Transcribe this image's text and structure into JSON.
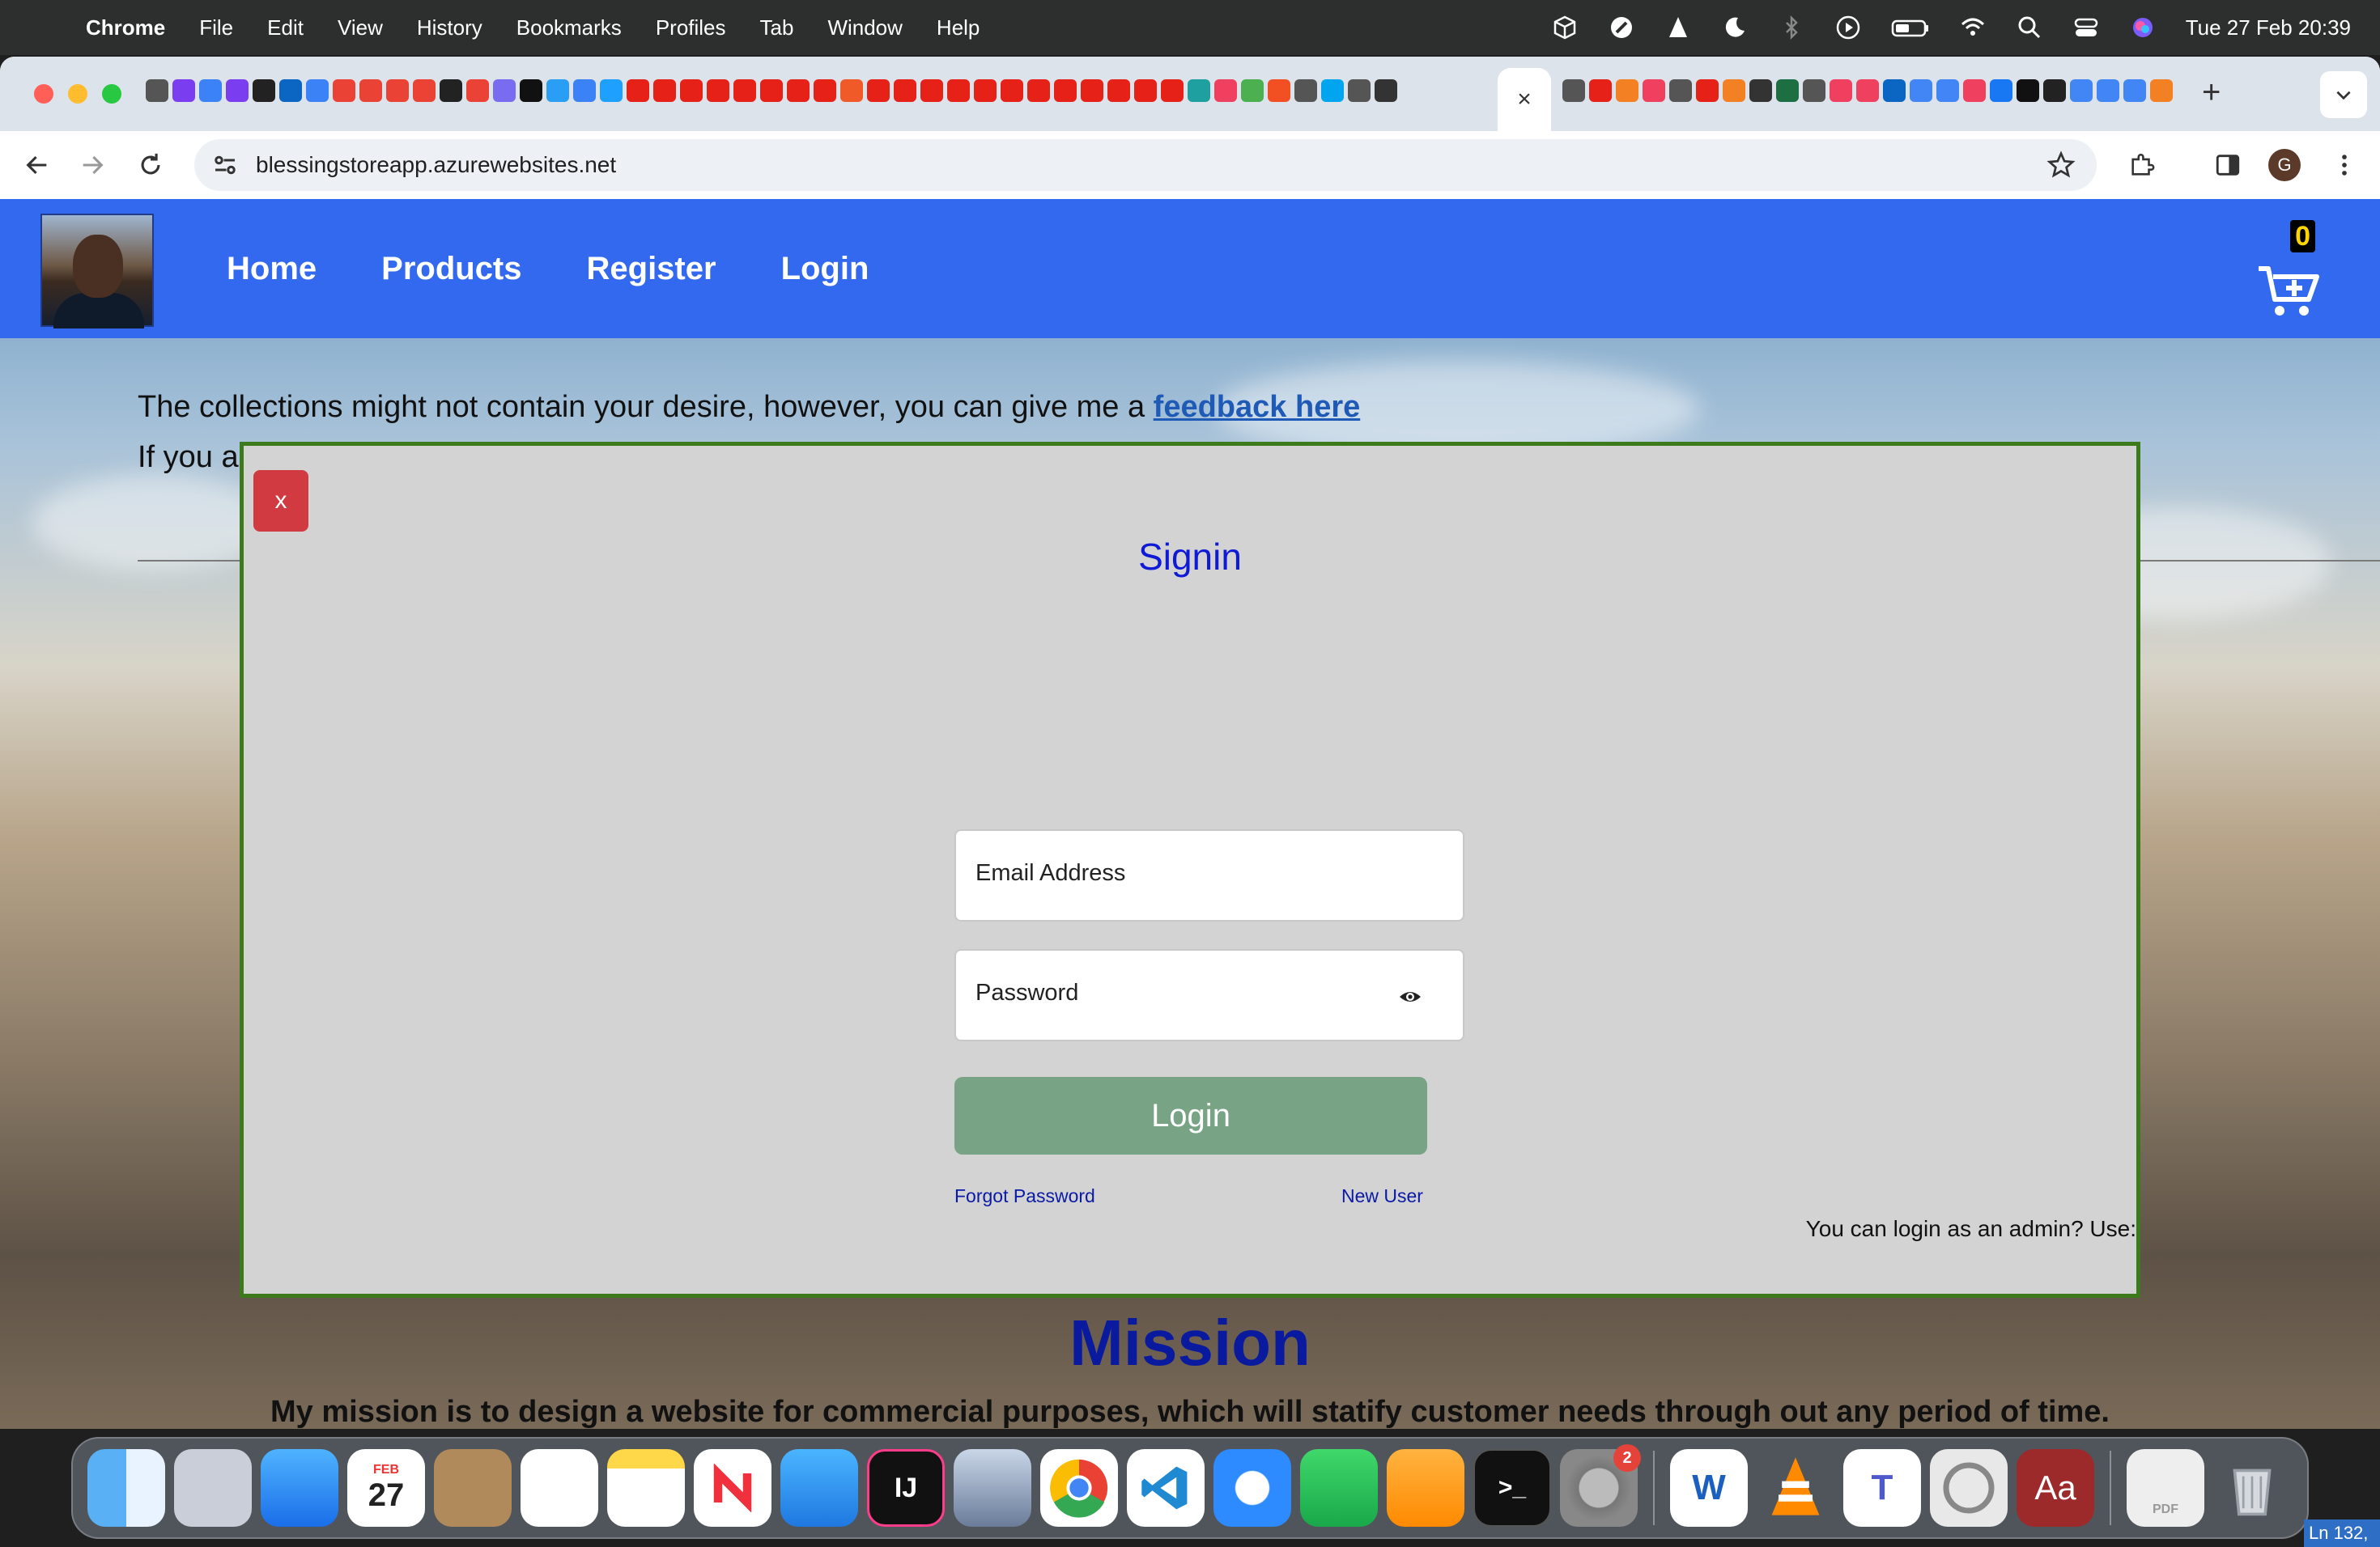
{
  "menubar": {
    "app_name": "Chrome",
    "items": [
      "File",
      "Edit",
      "View",
      "History",
      "Bookmarks",
      "Profiles",
      "Tab",
      "Window",
      "Help"
    ],
    "clock": "Tue 27 Feb  20:39"
  },
  "browser": {
    "url": "blessingstoreapp.azurewebsites.net",
    "profile_initial": "G",
    "active_tab_close": "×",
    "new_tab": "+"
  },
  "site": {
    "nav": [
      "Home",
      "Products",
      "Register",
      "Login"
    ],
    "cart_count": "0",
    "intro_text": "The collections might not contain your desire, however, you can give me a ",
    "feedback_link": "feedback here",
    "intro_line2": "If you a",
    "mission_title": "Mission",
    "mission_text": "My mission is to design a website for commercial purposes, which will statify customer needs through out any period of time."
  },
  "modal": {
    "close_label": "x",
    "title": "Signin",
    "email_label": "Email Address",
    "password_label": "Password",
    "login_button": "Login",
    "forgot_password": "Forgot Password",
    "new_user": "New User",
    "admin_note": "You can login as an admin? Use:"
  },
  "dock": {
    "calendar_month": "FEB",
    "calendar_day": "27",
    "settings_badge": "2",
    "intellij_label": "IJ",
    "word_label": "W",
    "teams_label": "T",
    "dictionary_label": "Aa",
    "terminal_label": ">_",
    "pdf_label": "PDF"
  },
  "status_corner": "Ln 132,"
}
